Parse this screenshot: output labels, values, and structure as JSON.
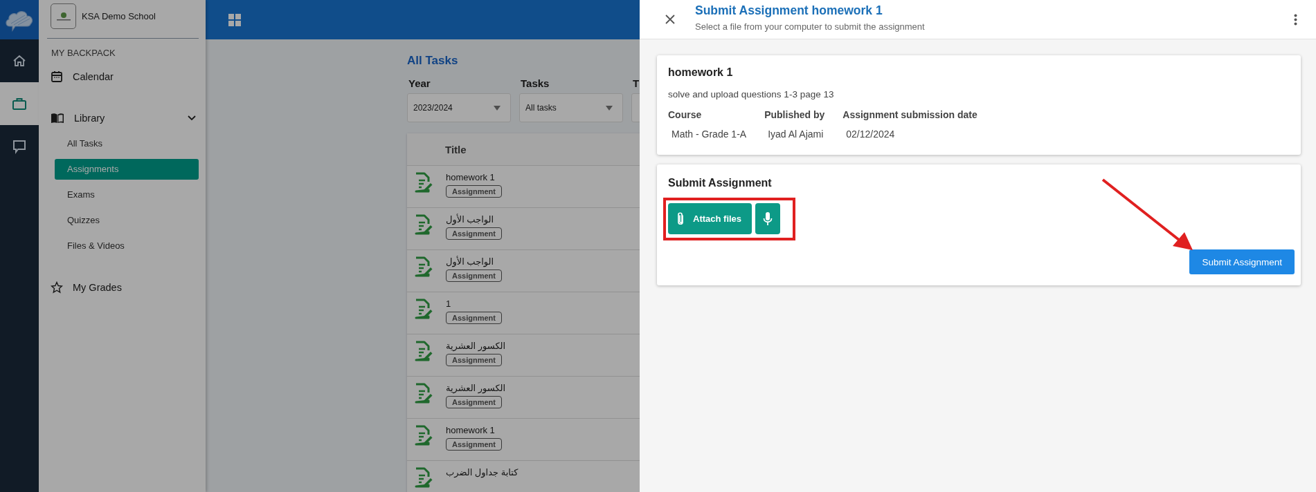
{
  "rail": {
    "items": [
      {
        "kind": "home",
        "selected": false
      },
      {
        "kind": "backpack",
        "selected": true
      },
      {
        "kind": "chat",
        "selected": false
      }
    ]
  },
  "sidebar": {
    "school_name": "KSA Demo School",
    "section_label": "MY BACKPACK",
    "items": [
      {
        "kind": "calendar",
        "label": "Calendar"
      },
      {
        "kind": "library",
        "label": "Library",
        "expanded": true,
        "children": [
          {
            "label": "All Tasks",
            "selected": false
          },
          {
            "label": "Assignments",
            "selected": true
          },
          {
            "label": "Exams",
            "selected": false
          },
          {
            "label": "Quizzes",
            "selected": false
          },
          {
            "label": "Files & Videos",
            "selected": false
          }
        ]
      },
      {
        "kind": "grades",
        "label": "My Grades"
      }
    ]
  },
  "main": {
    "title": "All Tasks",
    "filters": [
      {
        "label": "Year",
        "value": "2023/2024"
      },
      {
        "label": "Tasks",
        "value": "All tasks"
      },
      {
        "label": "T"
      }
    ],
    "table": {
      "columns": [
        "Title"
      ],
      "rows": [
        {
          "title": "homework 1",
          "tag": "Assignment"
        },
        {
          "title": "الواجب الأول",
          "tag": "Assignment"
        },
        {
          "title": "الواجب الأول",
          "tag": "Assignment"
        },
        {
          "title": "1",
          "tag": "Assignment"
        },
        {
          "title": "الكسور العشرية",
          "tag": "Assignment"
        },
        {
          "title": "الكسور العشرية",
          "tag": "Assignment"
        },
        {
          "title": "homework 1",
          "tag": "Assignment"
        },
        {
          "title": "كتابة جداول الضرب"
        }
      ]
    }
  },
  "drawer": {
    "title": "Submit Assignment homework 1",
    "subtitle": "Select a file from your computer to submit the assignment",
    "details": {
      "name": "homework 1",
      "description": "solve and upload questions 1-3 page 13",
      "fields": [
        {
          "label": "Course",
          "value": "Math - Grade 1-A"
        },
        {
          "label": "Published by",
          "value": "Iyad Al Ajami"
        },
        {
          "label": "Assignment submission date",
          "value": "02/12/2024"
        }
      ]
    },
    "submit": {
      "heading": "Submit Assignment",
      "attach_label": "Attach files",
      "submit_label": "Submit Assignment"
    }
  }
}
